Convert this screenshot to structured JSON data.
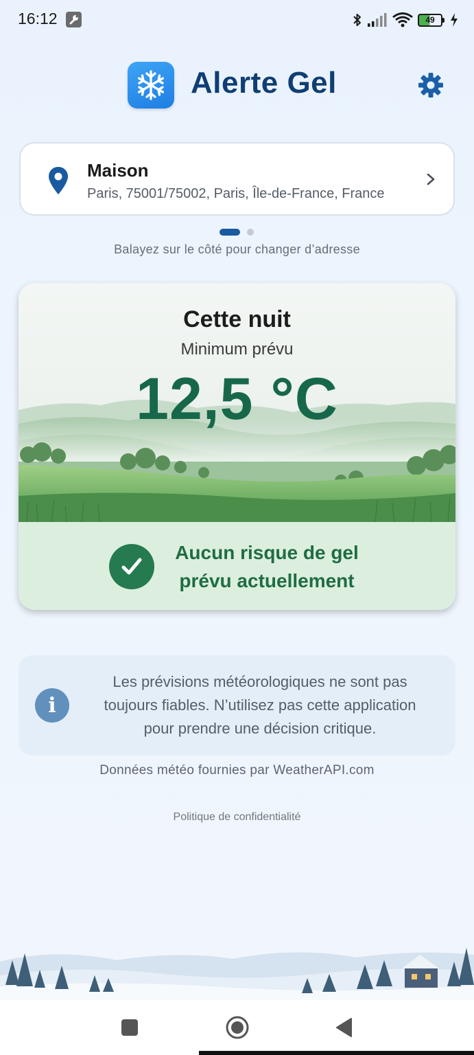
{
  "status_bar": {
    "time": "16:12",
    "battery_level": "49",
    "icons": [
      "wrench-icon",
      "bluetooth-icon",
      "signal-icon",
      "wifi-icon",
      "battery-icon",
      "charging-icon"
    ]
  },
  "header": {
    "app_name": "Alerte Gel",
    "app_icon": "snowflake-icon",
    "settings_icon": "gear-icon"
  },
  "address": {
    "name": "Maison",
    "line": "Paris, 75001/75002, Paris, Île-de-France, France",
    "pin_icon": "location-pin-icon",
    "pages_total": 2,
    "page_active": 1,
    "swipe_hint": "Balayez sur le côté pour changer d’adresse"
  },
  "forecast": {
    "title": "Cette nuit",
    "subtitle": "Minimum prévu",
    "temperature": "12,5 °C",
    "status_line1": "Aucun risque de gel",
    "status_line2": "prévu actuellement",
    "status_icon": "check-circle-icon"
  },
  "disclaimer": {
    "line1": "Les prévisions météorologiques ne sont pas",
    "line2": "toujours fiables. N’utilisez pas cette application",
    "line3": "pour prendre une décision critique.",
    "icon_glyph": "i"
  },
  "provider_text": "Données météo fournies par WeatherAPI.com",
  "privacy_link": "Politique de confidentialité",
  "colors": {
    "brand_blue": "#103e73",
    "icon_blue": "#1e7ee3",
    "safe_green": "#17684a",
    "status_bg": "#dcefdf",
    "page_bg": "#eaf3fd"
  },
  "nav": {
    "recents_icon": "square-icon",
    "home_icon": "circle-icon",
    "back_icon": "triangle-back-icon"
  }
}
